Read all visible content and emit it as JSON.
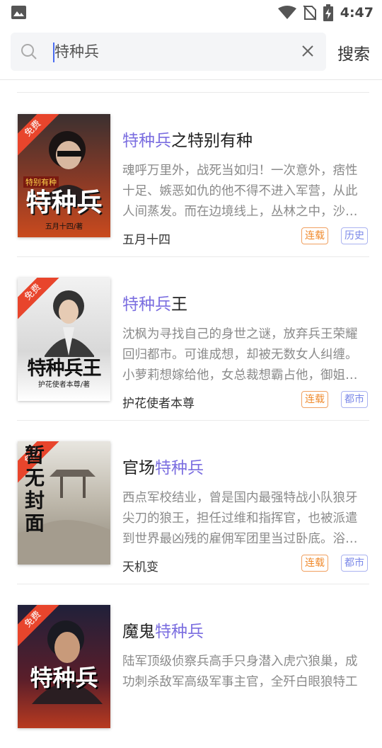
{
  "status_bar": {
    "time": "4:47"
  },
  "search": {
    "query": "特种兵",
    "button_label": "搜索"
  },
  "colors": {
    "highlight": "#7b6ee0",
    "status_tag": "#f08a2c",
    "category_tag": "#7b88e8",
    "ribbon": "#e8452c"
  },
  "books": [
    {
      "title_hl": "特种兵",
      "title_rest": "之特别有种",
      "title_prefix": "",
      "desc": "魂呼万里外，战死当如归！一次意外，痞性十足、嫉恶如仇的他不得不进入军营，从此人间蒸发。而在边境线上，丛林之中，沙…",
      "author": "五月十四",
      "status": "连载",
      "category": "历史",
      "cover": {
        "ribbon": "免费",
        "big": "特种兵",
        "small": "五月十四/著",
        "top": "特别有种"
      }
    },
    {
      "title_hl": "特种兵",
      "title_rest": "王",
      "title_prefix": "",
      "desc": "沈枫为寻找自己的身世之谜，放弃兵王荣耀回归都市。可谁成想，却被无数女人纠缠。小萝莉想嫁给他，女总裁想霸占他，御姐…",
      "author": "护花使者本尊",
      "status": "连载",
      "category": "都市",
      "cover": {
        "ribbon": "免费",
        "big": "特种兵王",
        "small": "护花使者本尊/著",
        "top": ""
      }
    },
    {
      "title_prefix": "官场",
      "title_hl": "特种兵",
      "title_rest": "",
      "desc": "西点军校结业，曾是国内最强特战小队狼牙尖刀的狼王，担任过维和指挥官，也被派遣到世界最凶残的雇佣军团里当过卧底。浴…",
      "author": "天机变",
      "status": "连载",
      "category": "都市",
      "cover": {
        "ribbon": "免费",
        "big": "暂无封面",
        "small": "",
        "top": ""
      }
    },
    {
      "title_prefix": "魔鬼",
      "title_hl": "特种兵",
      "title_rest": "",
      "desc": "陆军顶级侦察兵高手只身潜入虎穴狼巢，成功刺杀敌军高级军事主官，全歼白眼狼特工",
      "author": "",
      "status": "",
      "category": "",
      "cover": {
        "ribbon": "免费",
        "big": "特种兵",
        "small": "",
        "top": ""
      }
    }
  ]
}
